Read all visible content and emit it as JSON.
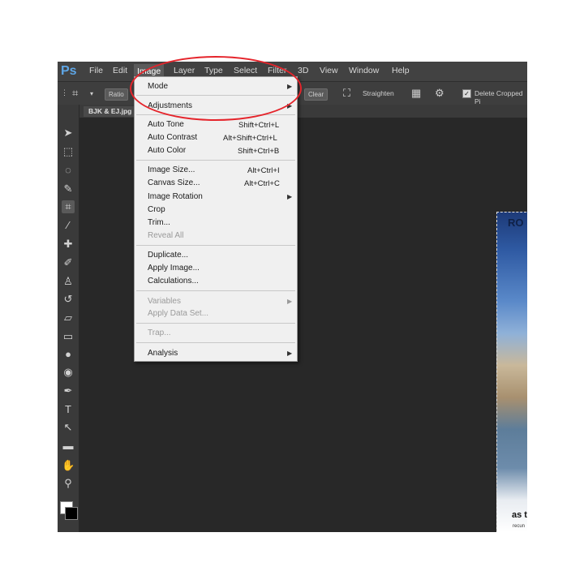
{
  "app": {
    "logo": "Ps"
  },
  "menubar": [
    {
      "label": "File"
    },
    {
      "label": "Edit"
    },
    {
      "label": "Image"
    },
    {
      "label": "Layer"
    },
    {
      "label": "Type"
    },
    {
      "label": "Select"
    },
    {
      "label": "Filter"
    },
    {
      "label": "3D"
    },
    {
      "label": "View"
    },
    {
      "label": "Window"
    },
    {
      "label": "Help"
    }
  ],
  "optionsbar": {
    "ratio_label": "Ratio",
    "clear_label": "Clear",
    "straighten_label": "Straighten",
    "delete_cropped_label": "Delete Cropped Pi"
  },
  "document": {
    "tab_title": "BJK & EJ.jpg"
  },
  "canvas_text": {
    "top": "RO",
    "bottom": "as t",
    "small": "recun"
  },
  "image_menu": {
    "mode": "Mode",
    "adjustments": "Adjustments",
    "auto_tone": "Auto Tone",
    "auto_tone_sc": "Shift+Ctrl+L",
    "auto_contrast": "Auto Contrast",
    "auto_contrast_sc": "Alt+Shift+Ctrl+L",
    "auto_color": "Auto Color",
    "auto_color_sc": "Shift+Ctrl+B",
    "image_size": "Image Size...",
    "image_size_sc": "Alt+Ctrl+I",
    "canvas_size": "Canvas Size...",
    "canvas_size_sc": "Alt+Ctrl+C",
    "image_rotation": "Image Rotation",
    "crop": "Crop",
    "trim": "Trim...",
    "reveal_all": "Reveal All",
    "duplicate": "Duplicate...",
    "apply_image": "Apply Image...",
    "calculations": "Calculations...",
    "variables": "Variables",
    "apply_data_set": "Apply Data Set...",
    "trap": "Trap...",
    "analysis": "Analysis"
  },
  "colors": {
    "annotation": "#e5242b",
    "menu_bg": "#f0f0f0",
    "app_bg": "#282828"
  },
  "icons": [
    "move-icon",
    "marquee-icon",
    "lasso-icon",
    "quick-select-icon",
    "crop-icon",
    "eyedropper-icon",
    "healing-icon",
    "brush-icon",
    "stamp-icon",
    "history-brush-icon",
    "eraser-icon",
    "gradient-icon",
    "blur-icon",
    "dodge-icon",
    "pen-icon",
    "type-icon",
    "path-select-icon",
    "shape-icon",
    "hand-icon",
    "zoom-icon"
  ]
}
